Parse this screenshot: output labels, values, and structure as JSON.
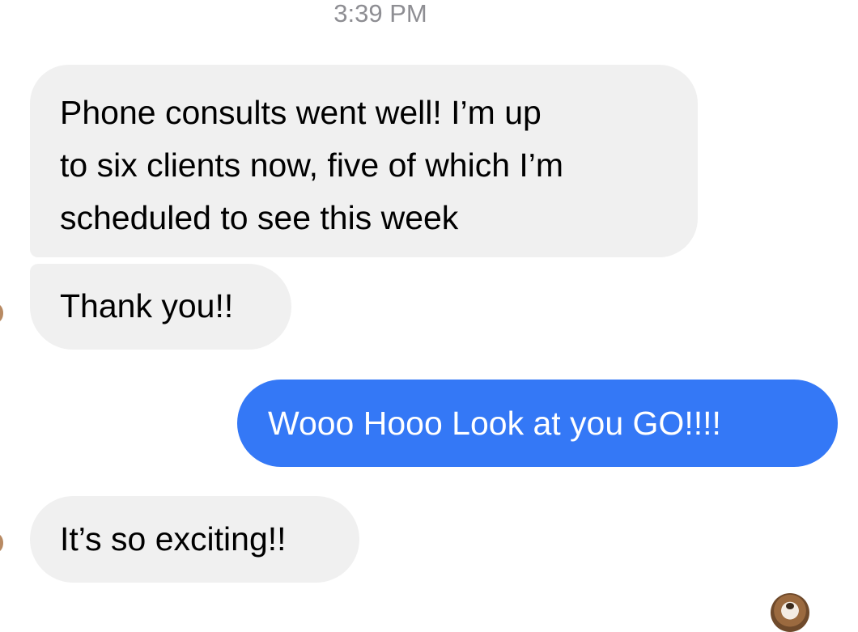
{
  "conversation": {
    "timestamp": "3:39 PM",
    "messages": [
      {
        "direction": "incoming",
        "lines": [
          "Phone consults went well! I’m up",
          "to six clients now, five of which I’m",
          "scheduled to see this week"
        ]
      },
      {
        "direction": "incoming",
        "text": "Thank you!!"
      },
      {
        "direction": "outgoing",
        "text": "Wooo Hooo Look at you GO!!!!"
      },
      {
        "direction": "incoming",
        "text": "It’s so exciting!!"
      }
    ]
  },
  "colors": {
    "incoming_bubble": "#f0f0f0",
    "outgoing_bubble": "#3478f6",
    "timestamp_text": "#8e8e93"
  },
  "icons": {
    "contact_avatar": "contact-avatar-icon",
    "read_receipt_avatar": "read-receipt-avatar-icon"
  }
}
